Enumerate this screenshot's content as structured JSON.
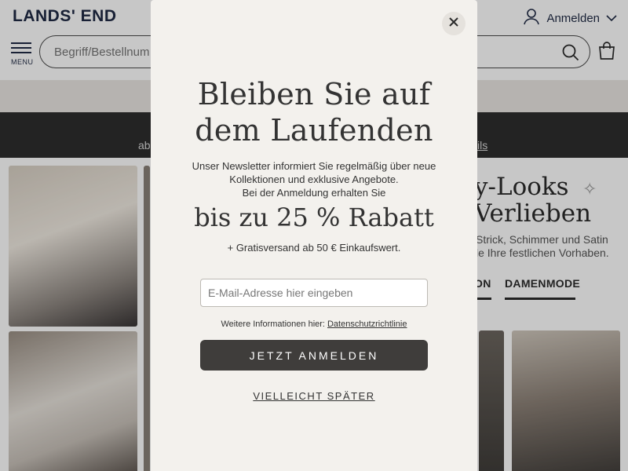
{
  "header": {
    "logo": "LANDS' END",
    "signin_label": "Anmelden",
    "menu_label": "MENU",
    "search_placeholder": "Begriff/Bestellnum"
  },
  "promo": {
    "left_text": "ab",
    "right_link": "ils"
  },
  "hero": {
    "title": "y-Looks\nVerlieben",
    "subtitle": "Strick, Schimmer und Satin\nle Ihre festlichen Vorhaben.",
    "tabs": [
      "ON",
      "DAMENMODE"
    ]
  },
  "modal": {
    "title": "Bleiben Sie auf\ndem Laufenden",
    "body": "Unser Newsletter informiert Sie regelmäßig über neue\nKollektionen und exklusive Angebote.\nBei der Anmeldung erhalten Sie",
    "discount": "bis zu 25 % Rabatt",
    "shipping": "+ Gratisversand ab 50 € Einkaufswert.",
    "email_placeholder": "E-Mail-Adresse hier eingeben",
    "info_text": "Weitere Informationen hier:",
    "privacy_link": "Datenschutzrichtlinie",
    "submit_label": "JETZT ANMELDEN",
    "later_label": "VIELLEICHT SPÄTER"
  },
  "icons": {
    "close": "close-icon",
    "search": "search-icon",
    "user": "user-icon",
    "bag": "shopping-bag-icon",
    "chevron": "chevron-down-icon",
    "menu": "menu-icon",
    "sparkle": "sparkle-icon"
  },
  "colors": {
    "modal_bg": "#f3f1ed",
    "button_bg": "#3f3d3b",
    "promo_bar": "#2d2d2d",
    "brand": "#1f2a44"
  }
}
